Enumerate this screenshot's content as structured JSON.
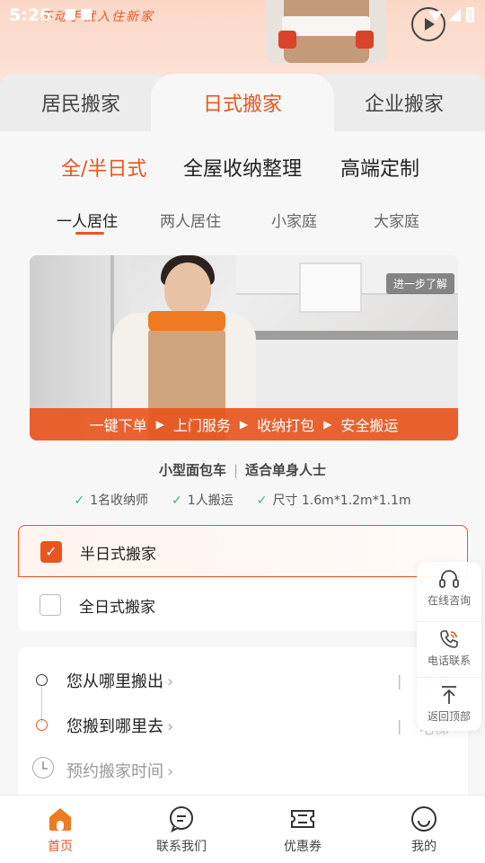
{
  "status_bar": {
    "time": "5:26"
  },
  "hero": {
    "slogan": "不动手就入住新家"
  },
  "main_tabs": [
    {
      "label": "居民搬家",
      "active": false
    },
    {
      "label": "日式搬家",
      "active": true
    },
    {
      "label": "企业搬家",
      "active": false
    }
  ],
  "sub_tabs": [
    {
      "label": "全/半日式",
      "active": true
    },
    {
      "label": "全屋收纳整理",
      "active": false
    },
    {
      "label": "高端定制",
      "active": false
    }
  ],
  "size_tabs": [
    {
      "label": "一人居住",
      "active": true
    },
    {
      "label": "两人居住",
      "active": false
    },
    {
      "label": "小家庭",
      "active": false
    },
    {
      "label": "大家庭",
      "active": false
    }
  ],
  "video": {
    "more_label": "进一步了解",
    "steps": [
      "一键下单",
      "上门服务",
      "收纳打包",
      "安全搬运"
    ]
  },
  "vehicle": {
    "type": "小型面包车",
    "divider": "|",
    "suitable": "适合单身人士"
  },
  "features": [
    "1名收纳师",
    "1人搬运",
    "尺寸 1.6m*1.2m*1.1m"
  ],
  "options": [
    {
      "label": "半日式搬家",
      "checked": true
    },
    {
      "label": "全日式搬家",
      "checked": false
    }
  ],
  "address": {
    "from_label": "您从哪里搬出",
    "to_label": "您搬到哪里去",
    "time_label": "预约搬家时间",
    "elevator_label": "电梯",
    "divider": "|"
  },
  "floating": [
    {
      "label": "在线咨询",
      "icon": "headset-icon"
    },
    {
      "label": "电话联系",
      "icon": "phone-icon"
    },
    {
      "label": "返回顶部",
      "icon": "arrow-up-icon"
    }
  ],
  "bottom_nav": [
    {
      "label": "首页",
      "icon": "home-icon",
      "active": true
    },
    {
      "label": "联系我们",
      "icon": "chat-icon",
      "active": false
    },
    {
      "label": "优惠券",
      "icon": "coupon-icon",
      "active": false
    },
    {
      "label": "我的",
      "icon": "smile-icon",
      "active": false
    }
  ],
  "colors": {
    "accent": "#e8561f",
    "check_green": "#3bb56a",
    "hero_bg": "#fbd7c8"
  }
}
